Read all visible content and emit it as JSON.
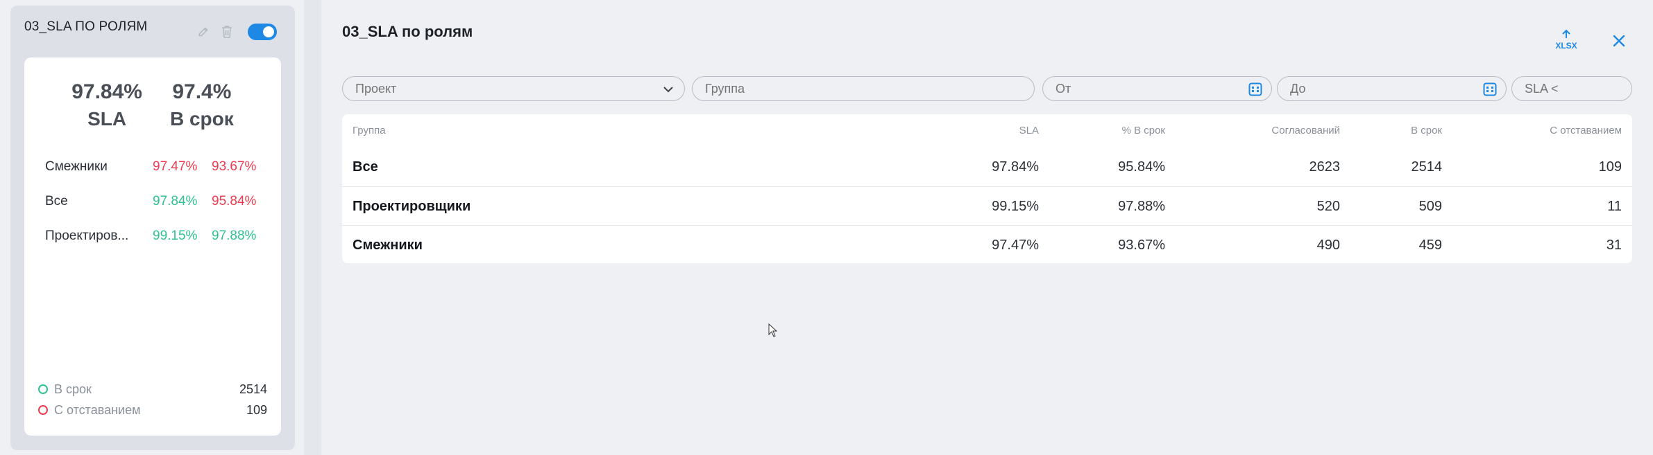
{
  "card": {
    "title": "03_SLA ПО РОЛЯМ",
    "sla_value": "97.84%",
    "sla_label": "SLA",
    "ontime_value": "97.4%",
    "ontime_label": "В срок",
    "rows": [
      {
        "name": "Смежники",
        "a": "97.47%",
        "b": "93.67%",
        "a_color": "red",
        "b_color": "red"
      },
      {
        "name": "Все",
        "a": "97.84%",
        "b": "95.84%",
        "a_color": "green",
        "b_color": "red"
      },
      {
        "name": "Проектиров...",
        "a": "99.15%",
        "b": "97.88%",
        "a_color": "green",
        "b_color": "green"
      }
    ],
    "legend": [
      {
        "label": "В срок",
        "value": "2514",
        "color": "#2fc18f"
      },
      {
        "label": "С отставанием",
        "value": "109",
        "color": "#ef3b4f"
      }
    ],
    "toggle_on": true
  },
  "panel": {
    "title": "03_SLA по ролям",
    "export_label": "XLSX"
  },
  "filters": {
    "project_placeholder": "Проект",
    "group_placeholder": "Группа",
    "from_placeholder": "От",
    "to_placeholder": "До",
    "sla_placeholder": "SLA <"
  },
  "table": {
    "headers": {
      "group": "Группа",
      "sla": "SLA",
      "pct_ontime": "% В срок",
      "approvals": "Согласований",
      "ontime": "В срок",
      "late": "С отставанием"
    },
    "rows": [
      {
        "group": "Все",
        "sla": "97.84%",
        "pct_ontime": "95.84%",
        "approvals": "2623",
        "ontime": "2514",
        "late": "109"
      },
      {
        "group": "Проектировщики",
        "sla": "99.15%",
        "pct_ontime": "97.88%",
        "approvals": "520",
        "ontime": "509",
        "late": "11"
      },
      {
        "group": "Смежники",
        "sla": "97.47%",
        "pct_ontime": "93.67%",
        "approvals": "490",
        "ontime": "459",
        "late": "31"
      }
    ]
  },
  "colors": {
    "accent": "#1e88e5",
    "green": "#2fc18f",
    "red": "#ef3b4f"
  }
}
